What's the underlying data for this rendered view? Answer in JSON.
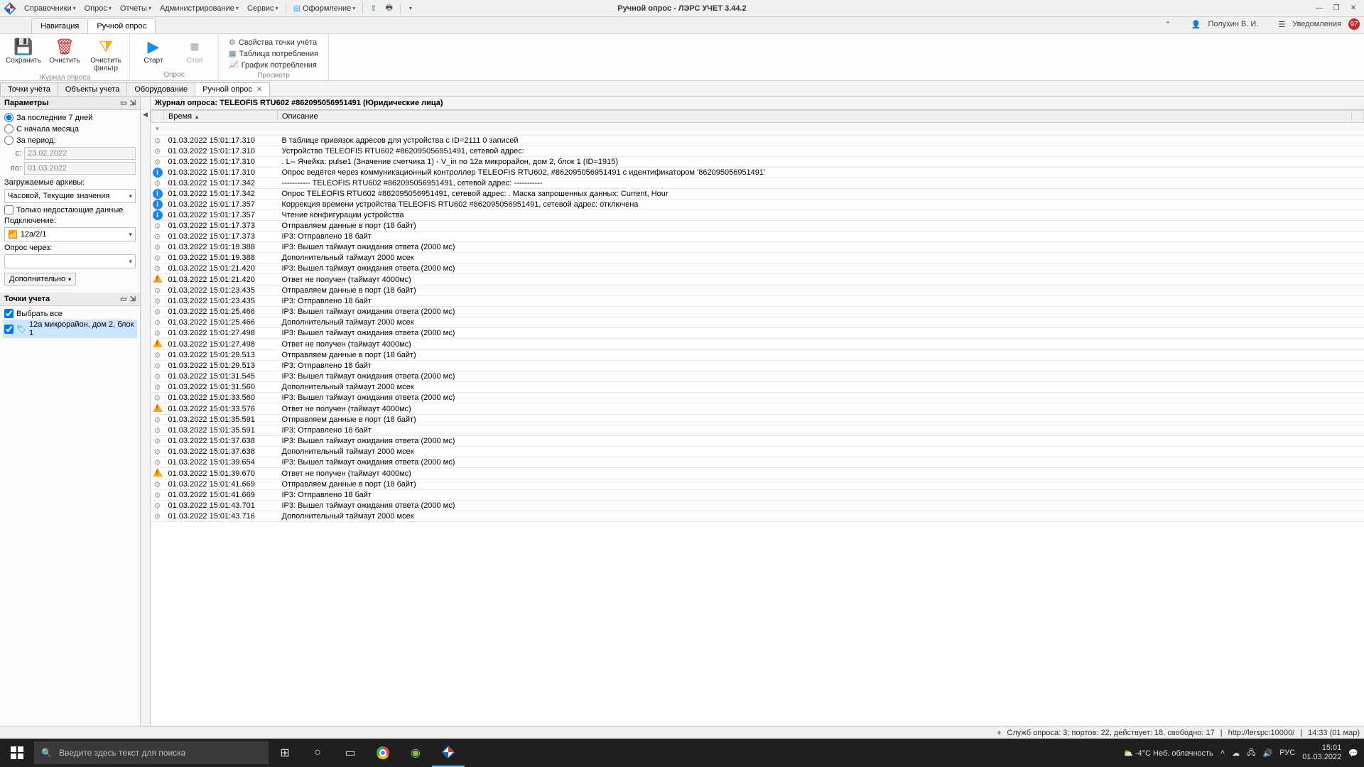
{
  "app": {
    "title": "Ручной опрос - ЛЭРС УЧЕТ 3.44.2"
  },
  "menu": {
    "items": [
      "Справочники",
      "Опрос",
      "Отчеты",
      "Администрирование",
      "Сервис"
    ],
    "theme_label": "Оформление"
  },
  "nav_tabs": {
    "items": [
      "Навигация",
      "Ручной опрос"
    ],
    "active_index": 1
  },
  "user": {
    "name": "Полухин В. И.",
    "notifications_label": "Уведомления",
    "badge": 97
  },
  "ribbon": {
    "group1": {
      "caption": "Журнал опроса",
      "save": "Сохранить",
      "clear": "Очистить",
      "clear_filter": "Очистить фильтр"
    },
    "group2": {
      "caption": "Опрос",
      "start": "Старт",
      "stop": "Стоп"
    },
    "group3": {
      "caption": "Просмотр",
      "props": "Свойства точки учёта",
      "table": "Таблица потребления",
      "chart": "График потребления"
    }
  },
  "doc_tabs": {
    "items": [
      "Точки учёта",
      "Объекты учета",
      "Оборудование",
      "Ручной опрос"
    ],
    "active_index": 3
  },
  "params_panel": {
    "title": "Параметры",
    "period": {
      "last7": "За последние 7 дней",
      "from_month": "С начала месяца",
      "range": "За период:",
      "selected": "last7",
      "from_label": "с:",
      "to_label": "по:",
      "from_value": "23.02.2022",
      "to_value": "01.03.2022"
    },
    "archives_label": "Загружаемые архивы:",
    "archives_value": "Часовой, Текущие значения",
    "only_missing": "Только недостающие данные",
    "connection_label": "Подключение:",
    "connection_value": "12a/2/1",
    "via_label": "Опрос через:",
    "via_value": "",
    "more_btn": "Дополнительно"
  },
  "points_panel": {
    "title": "Точки учета",
    "select_all": "Выбрать все",
    "tree": [
      "12а микрорайон, дом 2, блок 1"
    ]
  },
  "grid": {
    "title": "Журнал опроса: TELEOFIS RTU602 #862095056951491 (Юридические лица)",
    "columns": {
      "time": "Время",
      "desc": "Описание"
    },
    "rows": [
      {
        "lvl": "debug",
        "t": "01.03.2022 15:01:17.310",
        "d": "В таблице привязок адресов для устройства с ID=2111 0 записей"
      },
      {
        "lvl": "debug",
        "t": "01.03.2022 15:01:17.310",
        "d": "Устройство TELEOFIS RTU602 #862095056951491, сетевой адрес:"
      },
      {
        "lvl": "debug",
        "t": "01.03.2022 15:01:17.310",
        "d": ".   L-- Ячейка: pulse1 (Значение счетчика 1) - V_in по 12а микрорайон, дом 2, блок 1 (ID=1915)"
      },
      {
        "lvl": "info",
        "t": "01.03.2022 15:01:17.310",
        "d": "Опрос ведётся через коммуникационный контроллер TELEOFIS RTU602, #862095056951491 с идентификатором '862095056951491'"
      },
      {
        "lvl": "debug",
        "t": "01.03.2022 15:01:17.342",
        "d": "----------- TELEOFIS RTU602 #862095056951491, сетевой адрес:  -----------"
      },
      {
        "lvl": "info",
        "t": "01.03.2022 15:01:17.342",
        "d": "Опрос TELEOFIS RTU602 #862095056951491, сетевой адрес: . Маска запрошенных данных: Current, Hour"
      },
      {
        "lvl": "info",
        "t": "01.03.2022 15:01:17.357",
        "d": "Коррекция времени устройства TELEOFIS RTU602 #862095056951491, сетевой адрес:  отключена"
      },
      {
        "lvl": "info",
        "t": "01.03.2022 15:01:17.357",
        "d": "Чтение конфигурации устройства"
      },
      {
        "lvl": "debug",
        "t": "01.03.2022 15:01:17.373",
        "d": "Отправляем данные в порт (18 байт)"
      },
      {
        "lvl": "debug",
        "t": "01.03.2022 15:01:17.373",
        "d": "IP3: Отправлено 18 байт"
      },
      {
        "lvl": "debug",
        "t": "01.03.2022 15:01:19.388",
        "d": "IP3: Вышел таймаут ожидания ответа (2000 мс)"
      },
      {
        "lvl": "debug",
        "t": "01.03.2022 15:01:19.388",
        "d": "Дополнительный таймаут 2000 мсек"
      },
      {
        "lvl": "debug",
        "t": "01.03.2022 15:01:21.420",
        "d": "IP3: Вышел таймаут ожидания ответа (2000 мс)"
      },
      {
        "lvl": "warn",
        "t": "01.03.2022 15:01:21.420",
        "d": "Ответ не получен (таймаут 4000мс)"
      },
      {
        "lvl": "debug",
        "t": "01.03.2022 15:01:23.435",
        "d": "Отправляем данные в порт (18 байт)"
      },
      {
        "lvl": "debug",
        "t": "01.03.2022 15:01:23.435",
        "d": "IP3: Отправлено 18 байт"
      },
      {
        "lvl": "debug",
        "t": "01.03.2022 15:01:25.466",
        "d": "IP3: Вышел таймаут ожидания ответа (2000 мс)"
      },
      {
        "lvl": "debug",
        "t": "01.03.2022 15:01:25.466",
        "d": "Дополнительный таймаут 2000 мсек"
      },
      {
        "lvl": "debug",
        "t": "01.03.2022 15:01:27.498",
        "d": "IP3: Вышел таймаут ожидания ответа (2000 мс)"
      },
      {
        "lvl": "warn",
        "t": "01.03.2022 15:01:27.498",
        "d": "Ответ не получен (таймаут 4000мс)"
      },
      {
        "lvl": "debug",
        "t": "01.03.2022 15:01:29.513",
        "d": "Отправляем данные в порт (18 байт)"
      },
      {
        "lvl": "debug",
        "t": "01.03.2022 15:01:29.513",
        "d": "IP3: Отправлено 18 байт"
      },
      {
        "lvl": "debug",
        "t": "01.03.2022 15:01:31.545",
        "d": "IP3: Вышел таймаут ожидания ответа (2000 мс)"
      },
      {
        "lvl": "debug",
        "t": "01.03.2022 15:01:31.560",
        "d": "Дополнительный таймаут 2000 мсек"
      },
      {
        "lvl": "debug",
        "t": "01.03.2022 15:01:33.560",
        "d": "IP3: Вышел таймаут ожидания ответа (2000 мс)"
      },
      {
        "lvl": "warn",
        "t": "01.03.2022 15:01:33.576",
        "d": "Ответ не получен (таймаут 4000мс)"
      },
      {
        "lvl": "debug",
        "t": "01.03.2022 15:01:35.591",
        "d": "Отправляем данные в порт (18 байт)"
      },
      {
        "lvl": "debug",
        "t": "01.03.2022 15:01:35.591",
        "d": "IP3: Отправлено 18 байт"
      },
      {
        "lvl": "debug",
        "t": "01.03.2022 15:01:37.638",
        "d": "IP3: Вышел таймаут ожидания ответа (2000 мс)"
      },
      {
        "lvl": "debug",
        "t": "01.03.2022 15:01:37.638",
        "d": "Дополнительный таймаут 2000 мсек"
      },
      {
        "lvl": "debug",
        "t": "01.03.2022 15:01:39.654",
        "d": "IP3: Вышел таймаут ожидания ответа (2000 мс)"
      },
      {
        "lvl": "warn",
        "t": "01.03.2022 15:01:39.670",
        "d": "Ответ не получен (таймаут 4000мс)"
      },
      {
        "lvl": "debug",
        "t": "01.03.2022 15:01:41.669",
        "d": "Отправляем данные в порт (18 байт)"
      },
      {
        "lvl": "debug",
        "t": "01.03.2022 15:01:41.669",
        "d": "IP3: Отправлено 18 байт"
      },
      {
        "lvl": "debug",
        "t": "01.03.2022 15:01:43.701",
        "d": "IP3: Вышел таймаут ожидания ответа (2000 мс)"
      },
      {
        "lvl": "debug",
        "t": "01.03.2022 15:01:43.716",
        "d": "Дополнительный таймаут 2000 мсек"
      }
    ]
  },
  "status": {
    "text": "Служб опроса: 3; портов: 22, действует: 18, свободно: 17",
    "url": "http://lerspc:10000/",
    "time": "14:33 (01 мар)"
  },
  "taskbar": {
    "search_placeholder": "Введите здесь текст для поиска",
    "weather": "-4°C  Неб. облачность",
    "lang": "РУС",
    "time": "15:01",
    "date": "01.03.2022"
  }
}
